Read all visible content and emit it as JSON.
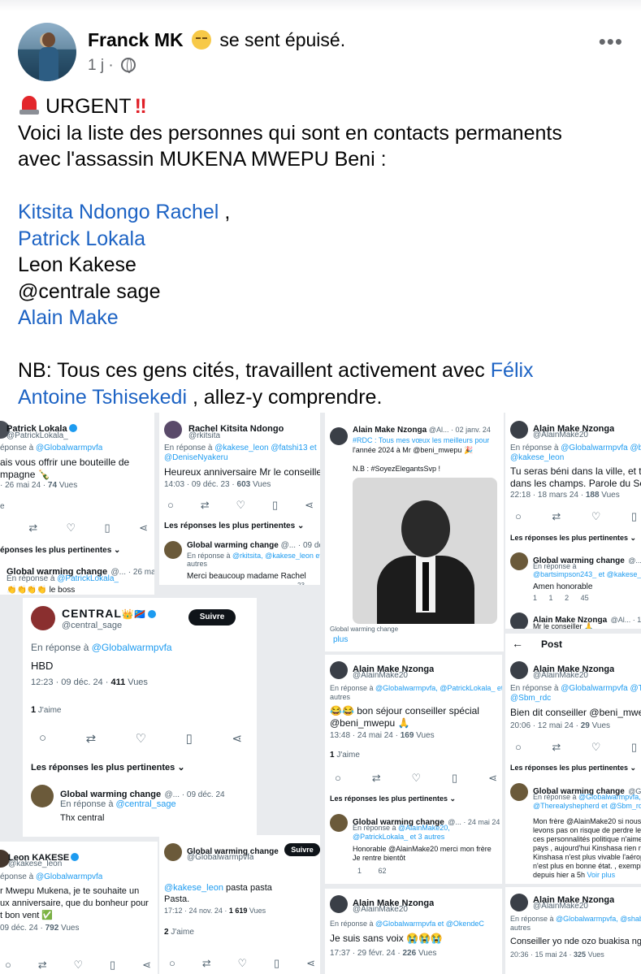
{
  "post": {
    "author": "Franck MK",
    "feeling": "se sent épuisé.",
    "time": "1 j",
    "lines": {
      "l1": "URGENT",
      "l2": "Voici la liste des personnes qui sont en contacts permanents",
      "l3": "avec l'assassin MUKENA MWEPU Beni :",
      "p1": "Kitsita Ndongo Rachel",
      "p1_suffix": " ,",
      "p2": "Patrick Lokala",
      "p3": "Leon Kakese",
      "p4": "@centrale sage",
      "p5": "Alain Make",
      "nb_prefix": "NB: Tous ces gens cités,  travaillent activement avec ",
      "nb_link1": "Félix",
      "nb_link2": "Antoine Tshisekedi",
      "nb_suffix": " , allez-y comprendre."
    }
  },
  "tweets": {
    "t1": {
      "name": "Patrick Lokala",
      "handle": "@PatrickLokala_",
      "reply_prefix": "éponse à ",
      "reply_link": "@Globalwarmpvfa",
      "text1": "ais vous offrir une bouteille de",
      "text2": "mpagne 🍾",
      "time": "· 26 mai 24 · ",
      "views": "74",
      "views_label": " Vues",
      "section": "éponses les plus pertinentes ⌄",
      "r_name": "Global warming change",
      "r_handle": "@... · 26 mai 24",
      "r_reply_prefix": "En réponse à ",
      "r_reply_link": "@PatrickLokala_",
      "r_text": "👏👏👏👏 le boss"
    },
    "t2": {
      "name": "Rachel Kitsita Ndongo",
      "handle": "@rkitsita",
      "reply_prefix": "En réponse à ",
      "reply_link": "@kakese_leon @fatshi13 et",
      "reply_link2": "@DeniseNyakeru",
      "text": "Heureux anniversaire Mr le conseiller.",
      "time": "14:03 · 09 déc. 23 · ",
      "views": "603",
      "views_label": " Vues",
      "section": "Les réponses les plus pertinentes ⌄",
      "r_name": "Global warming change",
      "r_handle": "@... · 09 déc. 2",
      "r_reply_prefix": "En réponse à ",
      "r_reply_link": "@rkitsita, @kakese_leon et",
      "r_reply2": "autres",
      "r_text": "Merci beaucoup madame Rachel",
      "r_stat": "23"
    },
    "t3": {
      "name": "CENTRAL",
      "name_badge": "👑🇨🇩",
      "handle": "@central_sage",
      "follow": "Suivre",
      "reply_prefix": "En réponse à ",
      "reply_link": "@Globalwarmpvfa",
      "text": "HBD",
      "time": "12:23 · 09 déc. 24 · ",
      "views": "411",
      "views_label": " Vues",
      "likes": "1",
      "likes_label": " J'aime",
      "section": "Les réponses les plus pertinentes ⌄",
      "r_name": "Global warming change",
      "r_handle": "@... · 09 déc. 24",
      "r_reply_prefix": "En réponse à ",
      "r_reply_link": "@central_sage",
      "r_text": "Thx central"
    },
    "t4": {
      "name": "Alain Make Nzonga",
      "handle": "@Al... · 02 janv. 24",
      "text1": "#RDC : Tous mes vœux les meilleurs pour",
      "text2": "l'année 2024 à Mr @beni_mwepu 🎉",
      "text3": "N.B : #SoyezElegantsSvp !",
      "caption": "Global warming change",
      "more": "plus"
    },
    "t5": {
      "name": "Alain Make Nzonga",
      "handle": "@AlainMake20",
      "reply_prefix": "En réponse à ",
      "reply_link": "@Globalwarmpvfa @bartsim",
      "reply_link2": "@kakese_leon",
      "text1": "Tu seras béni dans la ville, et tu se",
      "text2": "dans les champs. Parole du Seign",
      "time": "22:18 · 18 mars 24 · ",
      "views": "188",
      "views_label": " Vues",
      "section": "Les réponses les plus pertinentes ⌄",
      "r_name": "Global warming change",
      "r_handle": "@... · 18",
      "r_reply_prefix": "En réponse à ",
      "r_reply_link": "@bartsimpson243_ et @kakese_le",
      "r_text": "Amen  honorable",
      "r_s1": "1",
      "r_s2": "1",
      "r_s3": "2",
      "r_s4": "45",
      "q_name": "Alain Make Nzonga",
      "q_handle": "@Al... · 18",
      "q_text": "Mr le conseiller 🙏"
    },
    "t6": {
      "back": "←",
      "title": "Post",
      "name": "Alain Make Nzonga",
      "handle": "@AlainMake20",
      "reply_prefix": "En réponse à ",
      "reply_link": "@Globalwarmpvfa @Therealy",
      "reply_link2": "@Sbm_rdc",
      "text": "Bien dit conseiller @beni_mwepu !",
      "time": "20:06 · 12 mai 24 · ",
      "views": "29",
      "views_label": " Vues",
      "section": "Les réponses les plus pertinentes ⌄",
      "r_name": "Global warming change",
      "r_handle": "@G... · 1",
      "r_reply_prefix": "En réponse à ",
      "r_reply_link": "@Globalwarmpvfa,",
      "r_reply_link2": "@Therealyshepherd et @Sbm_rdc",
      "r_text1": "Mon frère @AlainMake20  si nous",
      "r_text2": "levons pas on risque de perdre le p",
      "r_text3": "ces personnalités politique n'aime",
      "r_text4": "pays , aujourd'hui Kinshasa  rien n",
      "r_text5": "Kinshasa n'est plus vivable l'aérop",
      "r_text6": "n'est plus en bonne état. , exempl",
      "r_text7": "depuis hier a 5h ",
      "r_more": "Voir plus"
    },
    "t7": {
      "name": "Alain Make Nzonga",
      "handle": "@AlainMake20",
      "reply_prefix": "En réponse à ",
      "reply_link": "@Globalwarmpvfa, @PatrickLokala_ et 3",
      "reply2": "autres",
      "text1": "😂😂 bon séjour conseiller spécial",
      "text2": "@beni_mwepu 🙏",
      "time": "13:48 · 24 mai 24 · ",
      "views": "169",
      "views_label": " Vues",
      "likes": "1",
      "likes_label": " J'aime",
      "section": "Les réponses les plus pertinentes ⌄",
      "r_name": "Global warming change",
      "r_handle": "@... · 24 mai 24",
      "r_reply_prefix": "En réponse à ",
      "r_reply_link": "@AlainMake20,",
      "r_reply_link2": "@PatrickLokala_ et 3 autres",
      "r_text1": "Honorable @AlainMake20  merci mon frère",
      "r_text2": "Je rentre bientôt",
      "r_s1": "1",
      "r_s2": "62"
    },
    "t8": {
      "name": "Leon KAKESE",
      "handle": "@kakese_leon",
      "reply_prefix": "éponse à ",
      "reply_link": "@Globalwarmpvfa",
      "text1": "r Mwepu Mukena, je te souhaite un",
      "text2": "ux anniversaire, que du bonheur pour",
      "text3": "t bon vent ✅",
      "time": "09 déc. 24 · ",
      "views": "792",
      "views_label": " Vues"
    },
    "t9": {
      "name": "Global warming change",
      "handle": "@Globalwarmpvfa",
      "follow": "Suivre",
      "text_link": "@kakese_leon",
      "text": "  pasta pasta",
      "text2": "Pasta.",
      "time": "17:12 · 24 nov. 24 · ",
      "views": "1 619",
      "views_label": " Vues",
      "likes": "2",
      "likes_label": " J'aime"
    },
    "t10": {
      "name": "Alain Make Nzonga",
      "handle": "@AlainMake20",
      "reply_prefix": "En réponse à ",
      "reply_link": "@Globalwarmpvfa et @OkendeC",
      "text": "Je suis sans voix 😭😭😭",
      "time": "17:37 · 29 févr. 24 · ",
      "views": "226",
      "views_label": " Vues"
    },
    "t11": {
      "name": "Alain Make Nzonga",
      "handle": "@AlainMake20",
      "reply_prefix": "En réponse à ",
      "reply_link": "@Globalwarmpvfa, @shaba",
      "reply2": "autres",
      "text": "Conseiller yo nde ozo buakisa nga",
      "time": "20:36 · 15 mai 24 · ",
      "views": "325",
      "views_label": " Vues"
    }
  },
  "colors": {
    "link": "#1d63c4",
    "twitter_link": "#1d9bf0",
    "muted": "#65676b"
  }
}
